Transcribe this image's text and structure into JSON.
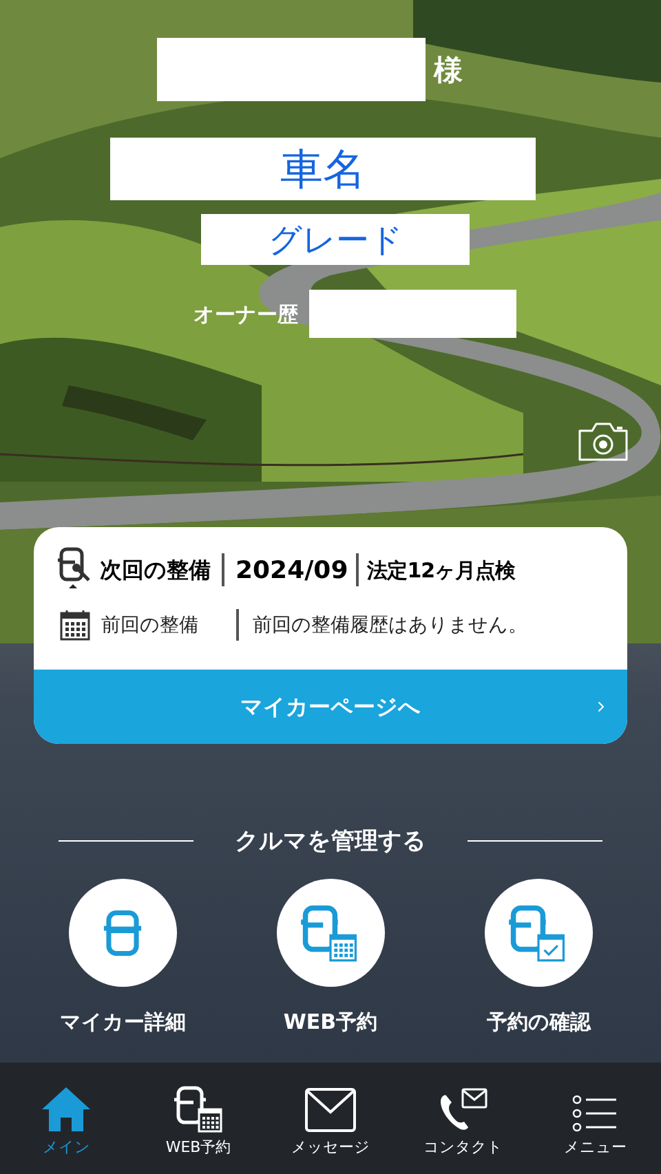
{
  "greeting": {
    "suffix": "様"
  },
  "car": {
    "name": "車名",
    "grade": "グレード",
    "ownership_label": "オーナー歴"
  },
  "maintenance": {
    "next": {
      "label": "次回の整備",
      "date": "2024/09",
      "type": "法定12ヶ月点検"
    },
    "previous": {
      "label": "前回の整備",
      "value": "前回の整備履歴はありません。"
    },
    "button": "マイカーページへ"
  },
  "section": {
    "title": "クルマを管理する",
    "actions": [
      {
        "label": "マイカー詳細",
        "kind": "car"
      },
      {
        "label": "WEB予約",
        "kind": "calendar"
      },
      {
        "label": "予約の確認",
        "kind": "check"
      }
    ]
  },
  "nav": [
    {
      "label": "メイン",
      "kind": "home",
      "selected": true
    },
    {
      "label": "WEB予約",
      "kind": "calendar",
      "selected": false
    },
    {
      "label": "メッセージ",
      "kind": "mail",
      "selected": false
    },
    {
      "label": "コンタクト",
      "kind": "contact",
      "selected": false
    },
    {
      "label": "メニュー",
      "kind": "menu",
      "selected": false
    }
  ]
}
